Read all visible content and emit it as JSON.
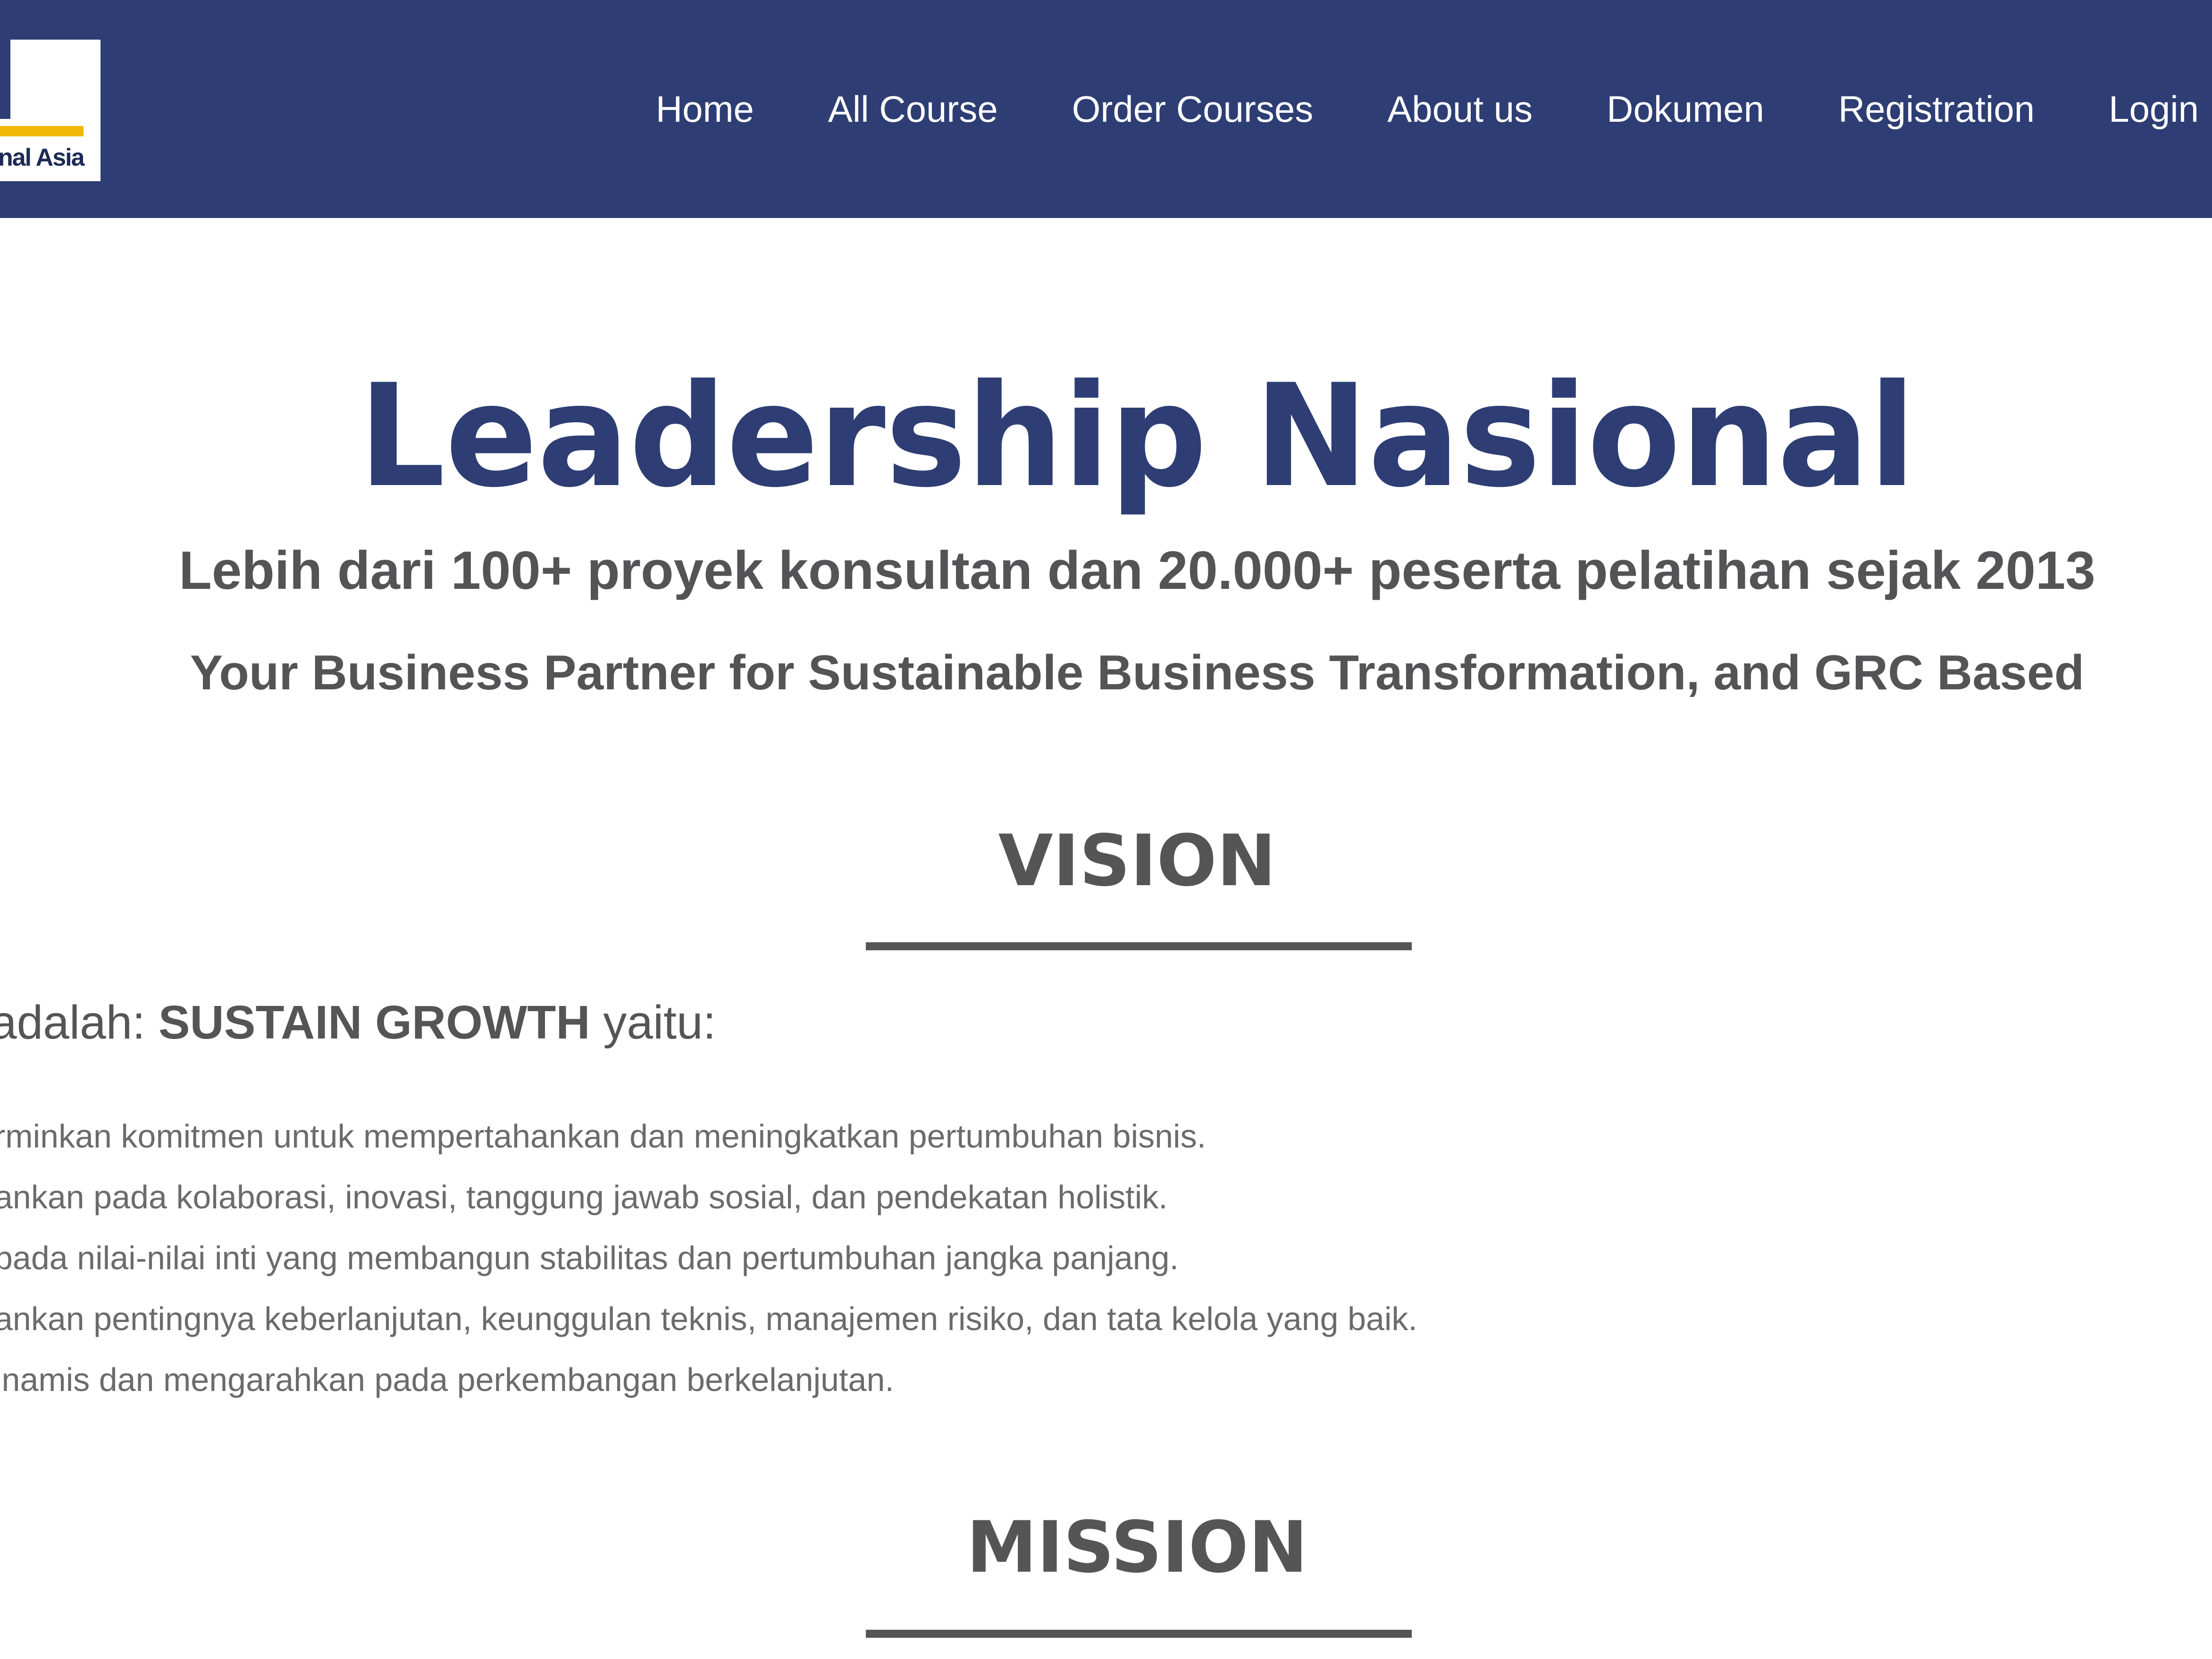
{
  "header": {
    "logo_text": "nal Asia",
    "nav": [
      {
        "label": "Home"
      },
      {
        "label": "All Course"
      },
      {
        "label": "Order Courses"
      },
      {
        "label": "About us"
      },
      {
        "label": "Dokumen"
      },
      {
        "label": "Registration"
      },
      {
        "label": "Login"
      }
    ]
  },
  "hero": {
    "title": "Leadership Nasional",
    "subtitle": "Lebih dari 100+ proyek konsultan dan 20.000+ peserta pelatihan sejak 2013",
    "tagline": "Your Business Partner for Sustainable Business Transformation, and GRC Based"
  },
  "vision": {
    "heading": "VISION",
    "intro_prefix": "adalah: ",
    "intro_bold": "SUSTAIN GROWTH",
    "intro_suffix": " yaitu:",
    "items": [
      "rminkan komitmen untuk mempertahankan dan meningkatkan pertumbuhan bisnis.",
      "ankan pada kolaborasi, inovasi, tanggung jawab sosial, dan pendekatan holistik.",
      "pada nilai-nilai inti yang membangun stabilitas dan pertumbuhan jangka panjang.",
      "ankan pentingnya keberlanjutan, keunggulan teknis, manajemen risiko, dan tata kelola yang baik.",
      "inamis dan mengarahkan pada perkembangan berkelanjutan."
    ]
  },
  "mission": {
    "heading": "MISSION"
  },
  "colors": {
    "header_bg": "#2e3e74",
    "title": "#2e3e74",
    "heading_gray": "#555555",
    "logo_accent": "#f2b705"
  }
}
